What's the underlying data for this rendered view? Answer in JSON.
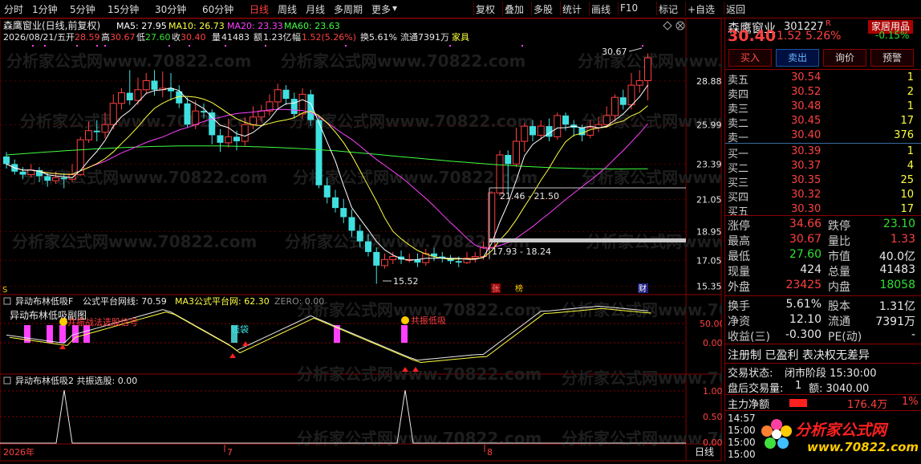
{
  "toolbar": {
    "periods": [
      "分时",
      "1分钟",
      "5分钟",
      "15分钟",
      "30分钟",
      "60分钟",
      "日线",
      "周线",
      "月线",
      "多周期",
      "更多"
    ],
    "active_period": "日线",
    "right_buttons": [
      "复权",
      "叠加",
      "多股",
      "统计",
      "画线",
      "F10",
      "标记",
      "+自选",
      "返回"
    ],
    "dropdown_mark": "▾"
  },
  "chart": {
    "title": "森鹰窗业(日线,前复权)",
    "info_date": "2026/08/21/五",
    "info_open_label": "开",
    "info_open": "28.59",
    "info_high_label": "高",
    "info_high": "30.67",
    "info_low_label": "低",
    "info_low": "27.60",
    "info_close_label": "收",
    "info_close": "30.40",
    "info_vol_label": "量",
    "info_vol": "41483",
    "info_amt_label": "额",
    "info_amt": "1.23亿",
    "info_chg_label": "幅",
    "info_chg": "1.52(5.26%)",
    "info_turnover": "换5.61%",
    "info_float": "流通7391万",
    "info_industry": "家具",
    "ma_labels": [
      {
        "text": "MA5: 27.95",
        "color": "#ffffff"
      },
      {
        "text": "MA10: 26.73",
        "color": "#ffff40"
      },
      {
        "text": "MA20: 23.33",
        "color": "#ff40ff"
      },
      {
        "text": "MA60: 23.63",
        "color": "#40ff40"
      }
    ],
    "y_ticks": [
      "28.88",
      "25.99",
      "23.39",
      "21.05",
      "18.95",
      "17.05",
      "15.35"
    ],
    "annotation_high": "30.67",
    "annotation_low": "15.52",
    "range_label_1": "21.46 - 21.50",
    "range_label_2": "17.93 - 18.24",
    "event_s": "S",
    "event_zhang": "张",
    "event_bang": "榜",
    "event_cai": "财",
    "watermark": "分析家公式网www.70822.com"
  },
  "indicator1": {
    "header_name": "异动布林低吸F",
    "header_line": "公式平台网线: 70.59",
    "header_ma3": "MA3公式平台网: 62.30",
    "header_zero": "ZERO: 0.00",
    "overlay_title": "异动布林低吸副图",
    "signal_text_1": "共振战法选股信号",
    "signal_text_2": "共振低吸",
    "signal_text_3": "钱袋",
    "y_ticks": [
      "50.00",
      "0.00"
    ]
  },
  "indicator2": {
    "header": "异动布林低吸2 共振选股: 0.00",
    "y_ticks": [
      "1.00",
      "0.50",
      "0.00"
    ]
  },
  "time_axis": {
    "year_label": "2026年",
    "month_7": "7",
    "month_8": "8",
    "period_label": "日线"
  },
  "quote": {
    "stock_name": "森鹰窗业",
    "stock_code": "301227",
    "r_mark": "R",
    "tag": "家居用品",
    "tag_change": "-0.15%",
    "last_price": "30.40",
    "change": "1.52",
    "change_pct": "5.26%",
    "buttons": [
      "买入",
      "卖出",
      "询价",
      "预警"
    ],
    "sells": [
      {
        "label": "卖五",
        "price": "30.54",
        "vol": "1"
      },
      {
        "label": "卖四",
        "price": "30.52",
        "vol": "2"
      },
      {
        "label": "卖三",
        "price": "30.48",
        "vol": "1"
      },
      {
        "label": "卖二",
        "price": "30.45",
        "vol": "17"
      },
      {
        "label": "卖一",
        "price": "30.40",
        "vol": "376"
      }
    ],
    "buys": [
      {
        "label": "买一",
        "price": "30.39",
        "vol": "1"
      },
      {
        "label": "买二",
        "price": "30.37",
        "vol": "4"
      },
      {
        "label": "买三",
        "price": "30.35",
        "vol": "25"
      },
      {
        "label": "买四",
        "price": "30.32",
        "vol": "10"
      },
      {
        "label": "买五",
        "price": "30.30",
        "vol": "17"
      }
    ],
    "stats": [
      {
        "l1": "涨停",
        "v1": "34.66",
        "c1": "#ff4040",
        "l2": "跌停",
        "v2": "23.10",
        "c2": "#30e030"
      },
      {
        "l1": "最高",
        "v1": "30.67",
        "c1": "#ff4040",
        "l2": "量比",
        "v2": "1.33",
        "c2": "#ff4040"
      },
      {
        "l1": "最低",
        "v1": "27.60",
        "c1": "#30e030",
        "l2": "市值",
        "v2": "40.0亿",
        "c2": "#e8e8e8"
      },
      {
        "l1": "现量",
        "v1": "424",
        "c1": "#e8e8e8",
        "l2": "总量",
        "v2": "41483",
        "c2": "#e8e8e8"
      },
      {
        "l1": "外盘",
        "v1": "23425",
        "c1": "#ff4040",
        "l2": "内盘",
        "v2": "18058",
        "c2": "#30e030"
      }
    ],
    "stats2": [
      {
        "l1": "换手",
        "v1": "5.61%",
        "l2": "股本",
        "v2": "1.31亿"
      },
      {
        "l1": "净资",
        "v1": "12.10",
        "l2": "流通",
        "v2": "7391万"
      },
      {
        "l1": "收益(三)",
        "v1": "-0.300",
        "l2": "PE(动)",
        "v2": "-"
      }
    ],
    "reg_info": "注册制 已盈利 表决权无差异",
    "trade_status_label": "交易状态:",
    "trade_status": "闭市阶段 15:30:00",
    "after_trade_label": "盘后交易量:",
    "after_trade_vol": "1",
    "after_trade_amt": "额: 3040.00",
    "main_net_label": "主力净额",
    "main_net_value": "176.4万",
    "main_net_pct": "1%",
    "ticks": [
      "14:57",
      "15:00",
      "15:00",
      "15:00"
    ],
    "brand_name": "分析家公式网",
    "brand_url": "www.70822.com"
  },
  "colors": {
    "up": "#ff4040",
    "down": "#40e0e0",
    "ma5": "#ffffff",
    "ma10": "#ffff40",
    "ma20": "#ff40ff",
    "ma60": "#40ff40",
    "grid": "#8b0000"
  }
}
